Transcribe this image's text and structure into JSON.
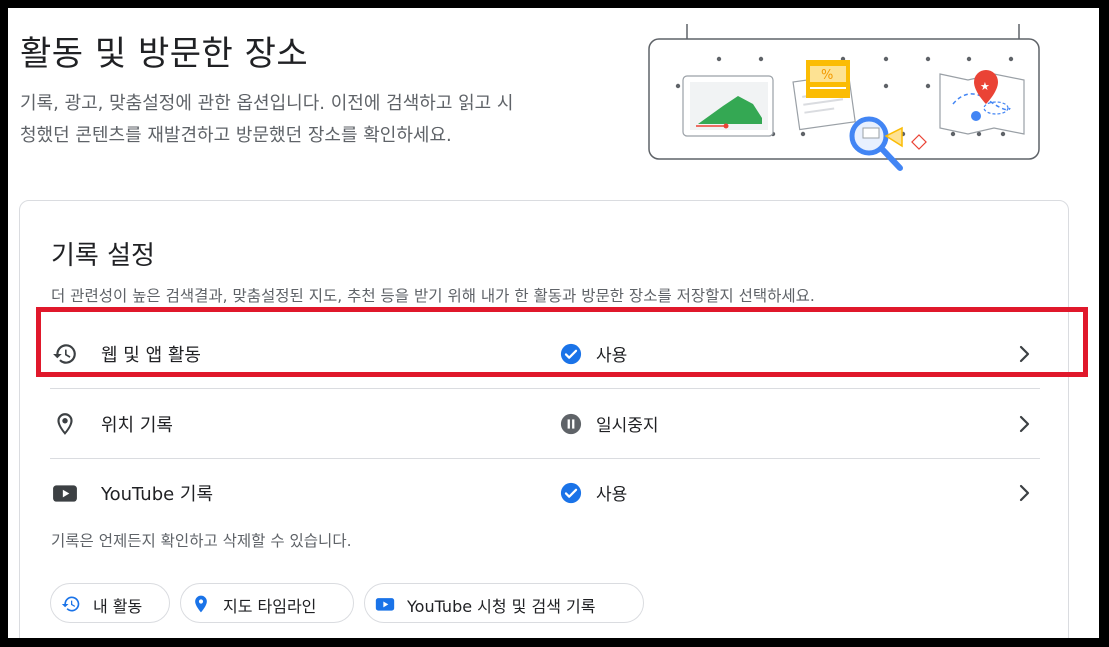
{
  "header": {
    "title": "활동 및 방문한 장소",
    "description_line1": "기록, 광고, 맞춤설정에 관한 옵션입니다. 이전에 검색하고 읽고 시",
    "description_line2": "청했던 콘텐츠를 재발견하고 방문했던 장소를 확인하세요."
  },
  "history_settings": {
    "title": "기록 설정",
    "description": "더 관련성이 높은 검색결과, 맞춤설정된 지도, 추천 등을 받기 위해 내가 한 활동과 방문한 장소를 저장할지 선택하세요.",
    "rows": [
      {
        "label": "웹 및 앱 활동",
        "status": "사용",
        "icon": "history-icon",
        "status_icon": "check-circle-icon"
      },
      {
        "label": "위치 기록",
        "status": "일시중지",
        "icon": "location-pin-icon",
        "status_icon": "pause-circle-icon"
      },
      {
        "label": "YouTube 기록",
        "status": "사용",
        "icon": "youtube-icon",
        "status_icon": "check-circle-icon"
      }
    ],
    "note": "기록은 언제든지 확인하고 삭제할 수 있습니다.",
    "chips": [
      {
        "label": "내 활동",
        "icon": "history-icon"
      },
      {
        "label": "지도 타임라인",
        "icon": "location-pin-icon"
      },
      {
        "label": "YouTube 시청 및 검색 기록",
        "icon": "youtube-icon"
      }
    ]
  },
  "colors": {
    "accent_blue": "#1a73e8",
    "pause_gray": "#5f6368",
    "highlight_red": "#e0182b",
    "youtube_blue": "#1a73e8"
  }
}
